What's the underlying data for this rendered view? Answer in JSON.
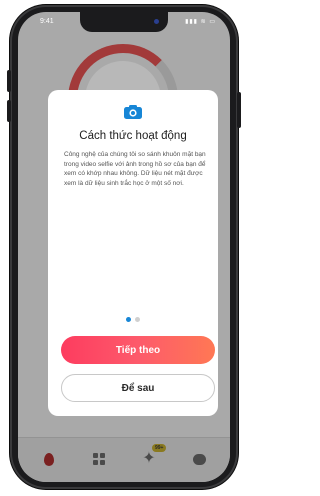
{
  "status": {
    "time": "9:41",
    "icons_text": "▮▮▮ ≋ ▭"
  },
  "modal": {
    "title": "Cách thức hoạt động",
    "body": "Công nghệ của chúng tôi so sánh khuôn mặt bạn trong video selfie với ảnh trong hồ sơ của bạn để xem có khớp nhau không. Dữ liệu nét mặt được xem là dữ liệu sinh trắc học ở một số nơi.",
    "primary_button": "Tiếp theo",
    "secondary_button": "Để sau",
    "pagination": {
      "total": 2,
      "current": 1
    }
  },
  "bottom_bar": {
    "badge": "99+"
  },
  "colors": {
    "accent": "#1786d6",
    "active_dot": "#1786d6",
    "inactive_dot": "#d0d0d0",
    "primary_gradient_start": "#fd3c5f",
    "primary_gradient_end": "#ff7854"
  },
  "icons": [
    "camera-icon",
    "flame-icon",
    "explore-grid-icon",
    "sparkle-star-icon",
    "chat-icon"
  ]
}
